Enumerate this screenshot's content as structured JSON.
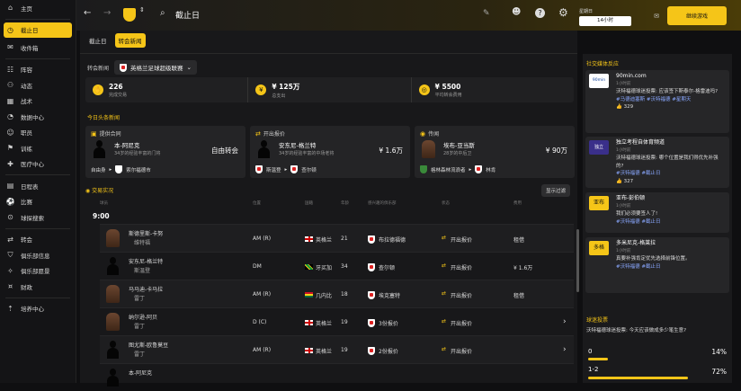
{
  "sidebar": {
    "items": [
      {
        "label": "主页",
        "icon": "home-icon"
      },
      {
        "label": "截止日",
        "icon": "clock-icon",
        "active": true
      },
      {
        "label": "收件箱",
        "icon": "inbox-icon"
      },
      {
        "label": "阵容",
        "icon": "squad-icon"
      },
      {
        "label": "动态",
        "icon": "dynamics-icon"
      },
      {
        "label": "战术",
        "icon": "tactics-icon"
      },
      {
        "label": "数据中心",
        "icon": "data-hub-icon"
      },
      {
        "label": "职员",
        "icon": "staff-icon"
      },
      {
        "label": "训练",
        "icon": "training-icon"
      },
      {
        "label": "医疗中心",
        "icon": "medical-icon"
      },
      {
        "label": "日程表",
        "icon": "calendar-icon"
      },
      {
        "label": "比赛",
        "icon": "match-icon"
      },
      {
        "label": "球探搜索",
        "icon": "scouting-icon"
      },
      {
        "label": "转会",
        "icon": "transfers-icon"
      },
      {
        "label": "俱乐部信息",
        "icon": "club-info-icon"
      },
      {
        "label": "俱乐部愿景",
        "icon": "club-vision-icon"
      },
      {
        "label": "财政",
        "icon": "finances-icon"
      },
      {
        "label": "培养中心",
        "icon": "development-icon"
      }
    ]
  },
  "topbar": {
    "title": "截止日"
  },
  "date": {
    "line1": "星期日",
    "line2": "14小时"
  },
  "continue_label": "继续游戏",
  "tabs": [
    "截止日",
    "转会新闻"
  ],
  "filter": {
    "label": "转会新闻",
    "value": "英格兰足球超级联赛"
  },
  "stats": [
    {
      "value": "226",
      "label": "完成交易",
      "icon": "handshake-icon"
    },
    {
      "value": "¥ 125万",
      "label": "总支出",
      "icon": "money-icon"
    },
    {
      "value": "¥ 5500",
      "label": "平均转会费用",
      "icon": "coins-icon"
    }
  ],
  "top_news_label": "今日头条新闻",
  "cards": [
    {
      "tag": "提供合同",
      "name": "本-阿尼克",
      "desc": "34岁的经验丰富的门将",
      "fee": "自由转会",
      "from": "自由身",
      "to": "索尔福德市"
    },
    {
      "tag": "开出报价",
      "name": "安东尼-格兰特",
      "desc": "34岁的经验丰富的中场老将",
      "fee": "¥ 1.6万",
      "from": "斯温登",
      "to": "查尔顿"
    },
    {
      "tag": "传闻",
      "name": "埃布-亚当斯",
      "desc": "28岁的中后卫",
      "fee": "¥ 90万",
      "from": "格林森林流浪者",
      "to": "林肯"
    }
  ],
  "live": {
    "label": "交易实况",
    "show_filter": "显示过滤",
    "columns": [
      "球员",
      "位置",
      "国籍",
      "年龄",
      "感兴趣的俱乐部",
      "状态",
      "费用"
    ],
    "time": "9:00",
    "rows": [
      {
        "name": "斯德里斯-卡努",
        "club": "维特福",
        "pos": "AM (R)",
        "nat": "英格兰",
        "flag": "en",
        "age": "21",
        "interest": "布拉德福德",
        "status": "开出报价",
        "fee": "租借"
      },
      {
        "name": "安东尼-格兰特",
        "club": "斯温登",
        "pos": "DM",
        "nat": "牙买加",
        "flag": "jm",
        "age": "34",
        "interest": "查尔顿",
        "status": "开出报价",
        "fee": "¥ 1.6万"
      },
      {
        "name": "马马迪-卡马拉",
        "club": "雷丁",
        "pos": "AM (R)",
        "nat": "几内比",
        "flag": "gh",
        "age": "18",
        "interest": "埃克塞特",
        "status": "开出报价",
        "fee": "租借"
      },
      {
        "name": "纳尔逊-阿贝",
        "club": "雷丁",
        "pos": "D (C)",
        "nat": "英格兰",
        "flag": "en",
        "age": "19",
        "interest": "3份报价",
        "status": "开出报价",
        "fee": ""
      },
      {
        "name": "图尤斯-欧鲁莫豆",
        "club": "雷丁",
        "pos": "AM (R)",
        "nat": "英格兰",
        "flag": "en",
        "age": "19",
        "interest": "2份报价",
        "status": "开出报价",
        "fee": ""
      },
      {
        "name": "本-阿尼克",
        "club": "",
        "pos": "",
        "nat": "",
        "flag": "",
        "age": "",
        "interest": "",
        "status": "",
        "fee": ""
      }
    ]
  },
  "social": {
    "label": "社交媒体反应",
    "posts": [
      {
        "who": "90min.com",
        "ago": "1小时前",
        "text": "沃特福德球迷投票: 应该签下斯泰尔-格雷迪吗?",
        "tags": "#马德迪塞斯 #沃特福德 #星期天",
        "likes": "329",
        "avatar": "90min"
      },
      {
        "who": "独立考程自体育频道",
        "ago": "1小时前",
        "text": "沃特福德球迷投票: 哪个位置是我们得优先补强的?",
        "tags": "#沃特福德 #截止日",
        "likes": "327",
        "avatar": "独立"
      },
      {
        "who": "亚布-彭伯顿",
        "ago": "1小时前",
        "text": "我们必须要签人了!",
        "tags": "#沃特福德 #截止日",
        "likes": "",
        "avatar": "亚布"
      },
      {
        "who": "多米尼克-格莱拉",
        "ago": "1小时前",
        "text": "真要补强肯定优先选择前锋位置。",
        "tags": "#沃特福德 #截止日",
        "likes": "",
        "avatar": "多格"
      }
    ]
  },
  "poll": {
    "label": "球迷投票",
    "question": "沃特福德球迷投票: 今天应该做成多少笔生意?",
    "options": [
      {
        "label": "0",
        "pct": "14%",
        "value": 0.14
      },
      {
        "label": "1-2",
        "pct": "72%",
        "value": 0.72
      }
    ]
  },
  "colors": {
    "accent": "#f5c518"
  }
}
